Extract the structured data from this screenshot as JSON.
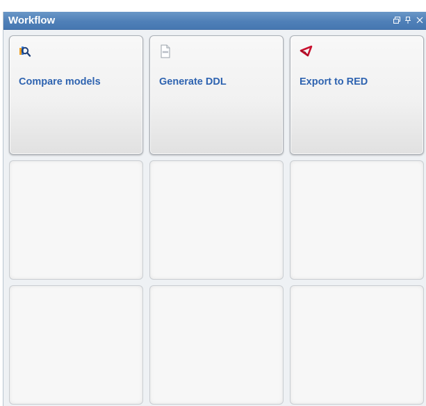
{
  "panel": {
    "title": "Workflow",
    "controls": [
      {
        "icon": "restore-icon"
      },
      {
        "icon": "pin-icon"
      },
      {
        "icon": "close-icon"
      }
    ]
  },
  "tiles": [
    {
      "label": "Compare models",
      "icon": "compare-models-icon"
    },
    {
      "label": "Generate DDL",
      "icon": "ddl-document-icon"
    },
    {
      "label": "Export to RED",
      "icon": "export-red-icon"
    },
    {
      "label": ""
    },
    {
      "label": ""
    },
    {
      "label": ""
    },
    {
      "label": ""
    },
    {
      "label": ""
    },
    {
      "label": ""
    }
  ],
  "colors": {
    "titlebar": "#4f80b8",
    "label": "#2e63b0",
    "accent_red": "#c8102e"
  }
}
